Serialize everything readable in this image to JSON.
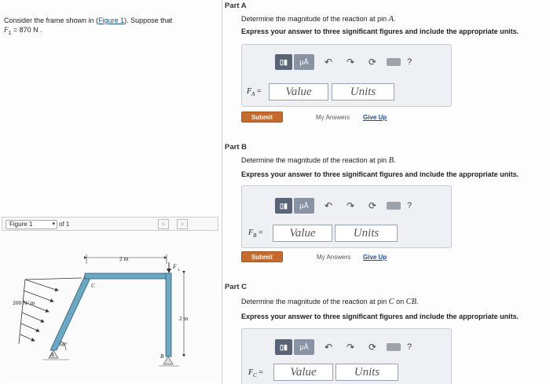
{
  "intro": {
    "line1_a": "Consider the frame shown in (",
    "figure_link": "Figure 1",
    "line1_b": "). Suppose that",
    "line2_a": "F",
    "line2_sub": "1",
    "line2_b": " = 870  N ."
  },
  "toolbar": {
    "template_icon": "template-icon",
    "mu_label": "μÅ",
    "undo_icon": "undo-icon",
    "redo_icon": "redo-icon",
    "reset_icon": "reset-icon",
    "keyboard_icon": "keyboard-icon",
    "help_label": "?"
  },
  "parts": [
    {
      "title": "Part A",
      "prompt_a": "Determine the magnitude of the reaction at pin ",
      "prompt_var": "A",
      "prompt_b": ".",
      "instruction": "Express your answer to three significant figures and include the appropriate units.",
      "field_label": "F",
      "field_sub": "A",
      "field_eq": " =",
      "value_placeholder": "Value",
      "units_placeholder": "Units",
      "submit": "Submit",
      "my_answers": "My Answers",
      "give_up": "Give Up"
    },
    {
      "title": "Part B",
      "prompt_a": "Determine the magnitude of the reaction at pin ",
      "prompt_var": "B",
      "prompt_b": ".",
      "instruction": "Express your answer to three significant figures and include the appropriate units.",
      "field_label": "F",
      "field_sub": "B",
      "field_eq": " =",
      "value_placeholder": "Value",
      "units_placeholder": "Units",
      "submit": "Submit",
      "my_answers": "My Answers",
      "give_up": "Give Up"
    },
    {
      "title": "Part C",
      "prompt_a": "Determine the magnitude of the reaction at pin ",
      "prompt_var": "C",
      "prompt_b": " on ",
      "prompt_var2": "CB",
      "prompt_c": ".",
      "instruction": "Express your answer to three significant figures and include the appropriate units.",
      "field_label": "F",
      "field_sub": "C",
      "field_eq": " =",
      "value_placeholder": "Value",
      "units_placeholder": "Units"
    }
  ],
  "figure": {
    "select_label": "Figure 1",
    "of_label": "of 1",
    "prev": "<",
    "next": ">",
    "dim_top": "2 m",
    "dim_right": "2 m",
    "load_label": "200 N/ m",
    "angle_label": "60°",
    "force_label": "F",
    "force_sub": "1",
    "pin_a": "A",
    "pin_b": "B",
    "pin_c": "C"
  }
}
